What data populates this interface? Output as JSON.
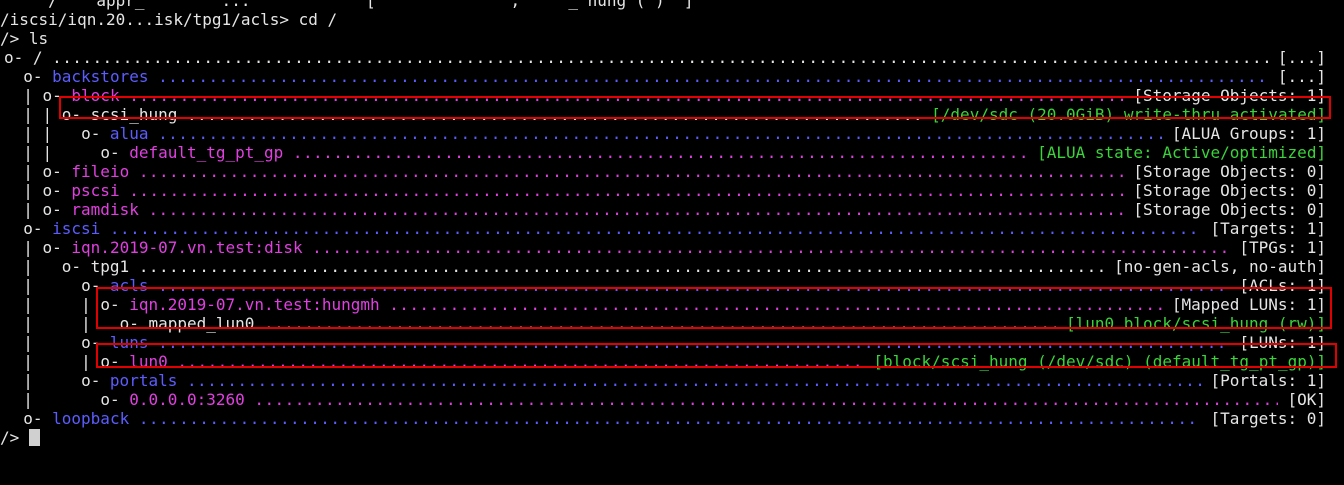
{
  "colors": {
    "background": "#000000",
    "text": "#e5e5e5",
    "node_blue": "#5c5cff",
    "node_magenta": "#e040e0",
    "status_green": "#3ad33a",
    "highlight_red": "#e00000"
  },
  "top_partial": "     /    appr_        ...            [              ,     _ hung ( )  ]",
  "prompt_cd": "/iscsi/iqn.20...isk/tpg1/acls> cd /",
  "prompt_ls": "/> ls",
  "prompt_final": "/>",
  "tree": [
    {
      "prefix": "o- ",
      "name": "/",
      "name_color": "white",
      "status": "[...]",
      "status_color": "white"
    },
    {
      "prefix": "  o- ",
      "name": "backstores",
      "name_color": "blue",
      "status": "[...]",
      "status_color": "white"
    },
    {
      "prefix": "  | o- ",
      "name": "block",
      "name_color": "magenta",
      "status": "[Storage Objects: 1]",
      "status_color": "white"
    },
    {
      "prefix": "  | | o- ",
      "name": "scsi_hung",
      "name_color": "white",
      "status": "[/dev/sdc (20.0GiB) write-thru activated]",
      "status_color": "green"
    },
    {
      "prefix": "  | |   o- ",
      "name": "alua",
      "name_color": "blue",
      "status": "[ALUA Groups: 1]",
      "status_color": "white"
    },
    {
      "prefix": "  | |     o- ",
      "name": "default_tg_pt_gp",
      "name_color": "magenta",
      "status": "[ALUA state: Active/optimized]",
      "status_color": "green"
    },
    {
      "prefix": "  | o- ",
      "name": "fileio",
      "name_color": "magenta",
      "status": "[Storage Objects: 0]",
      "status_color": "white"
    },
    {
      "prefix": "  | o- ",
      "name": "pscsi",
      "name_color": "magenta",
      "status": "[Storage Objects: 0]",
      "status_color": "white"
    },
    {
      "prefix": "  | o- ",
      "name": "ramdisk",
      "name_color": "magenta",
      "status": "[Storage Objects: 0]",
      "status_color": "white"
    },
    {
      "prefix": "  o- ",
      "name": "iscsi",
      "name_color": "blue",
      "status": "[Targets: 1]",
      "status_color": "white"
    },
    {
      "prefix": "  | o- ",
      "name": "iqn.2019-07.vn.test:disk",
      "name_color": "magenta",
      "status": "[TPGs: 1]",
      "status_color": "white"
    },
    {
      "prefix": "  |   o- ",
      "name": "tpg1",
      "name_color": "white",
      "status": "[no-gen-acls, no-auth]",
      "status_color": "white"
    },
    {
      "prefix": "  |     o- ",
      "name": "acls",
      "name_color": "blue",
      "status": "[ACLs: 1]",
      "status_color": "white"
    },
    {
      "prefix": "  |     | o- ",
      "name": "iqn.2019-07.vn.test:hungmh",
      "name_color": "magenta",
      "status": "[Mapped LUNs: 1]",
      "status_color": "white"
    },
    {
      "prefix": "  |     |   o- ",
      "name": "mapped_lun0",
      "name_color": "white",
      "status": "[lun0 block/scsi_hung (rw)]",
      "status_color": "green"
    },
    {
      "prefix": "  |     o- ",
      "name": "luns",
      "name_color": "blue",
      "status": "[LUNs: 1]",
      "status_color": "white"
    },
    {
      "prefix": "  |     | o- ",
      "name": "lun0",
      "name_color": "magenta",
      "status": "[block/scsi_hung (/dev/sdc) (default_tg_pt_gp)]",
      "status_color": "green"
    },
    {
      "prefix": "  |     o- ",
      "name": "portals",
      "name_color": "blue",
      "status": "[Portals: 1]",
      "status_color": "white"
    },
    {
      "prefix": "  |       o- ",
      "name": "0.0.0.0:3260",
      "name_color": "magenta",
      "status": "[OK]",
      "status_color": "white"
    },
    {
      "prefix": "  o- ",
      "name": "loopback",
      "name_color": "blue",
      "status": "[Targets: 0]",
      "status_color": "white"
    }
  ]
}
